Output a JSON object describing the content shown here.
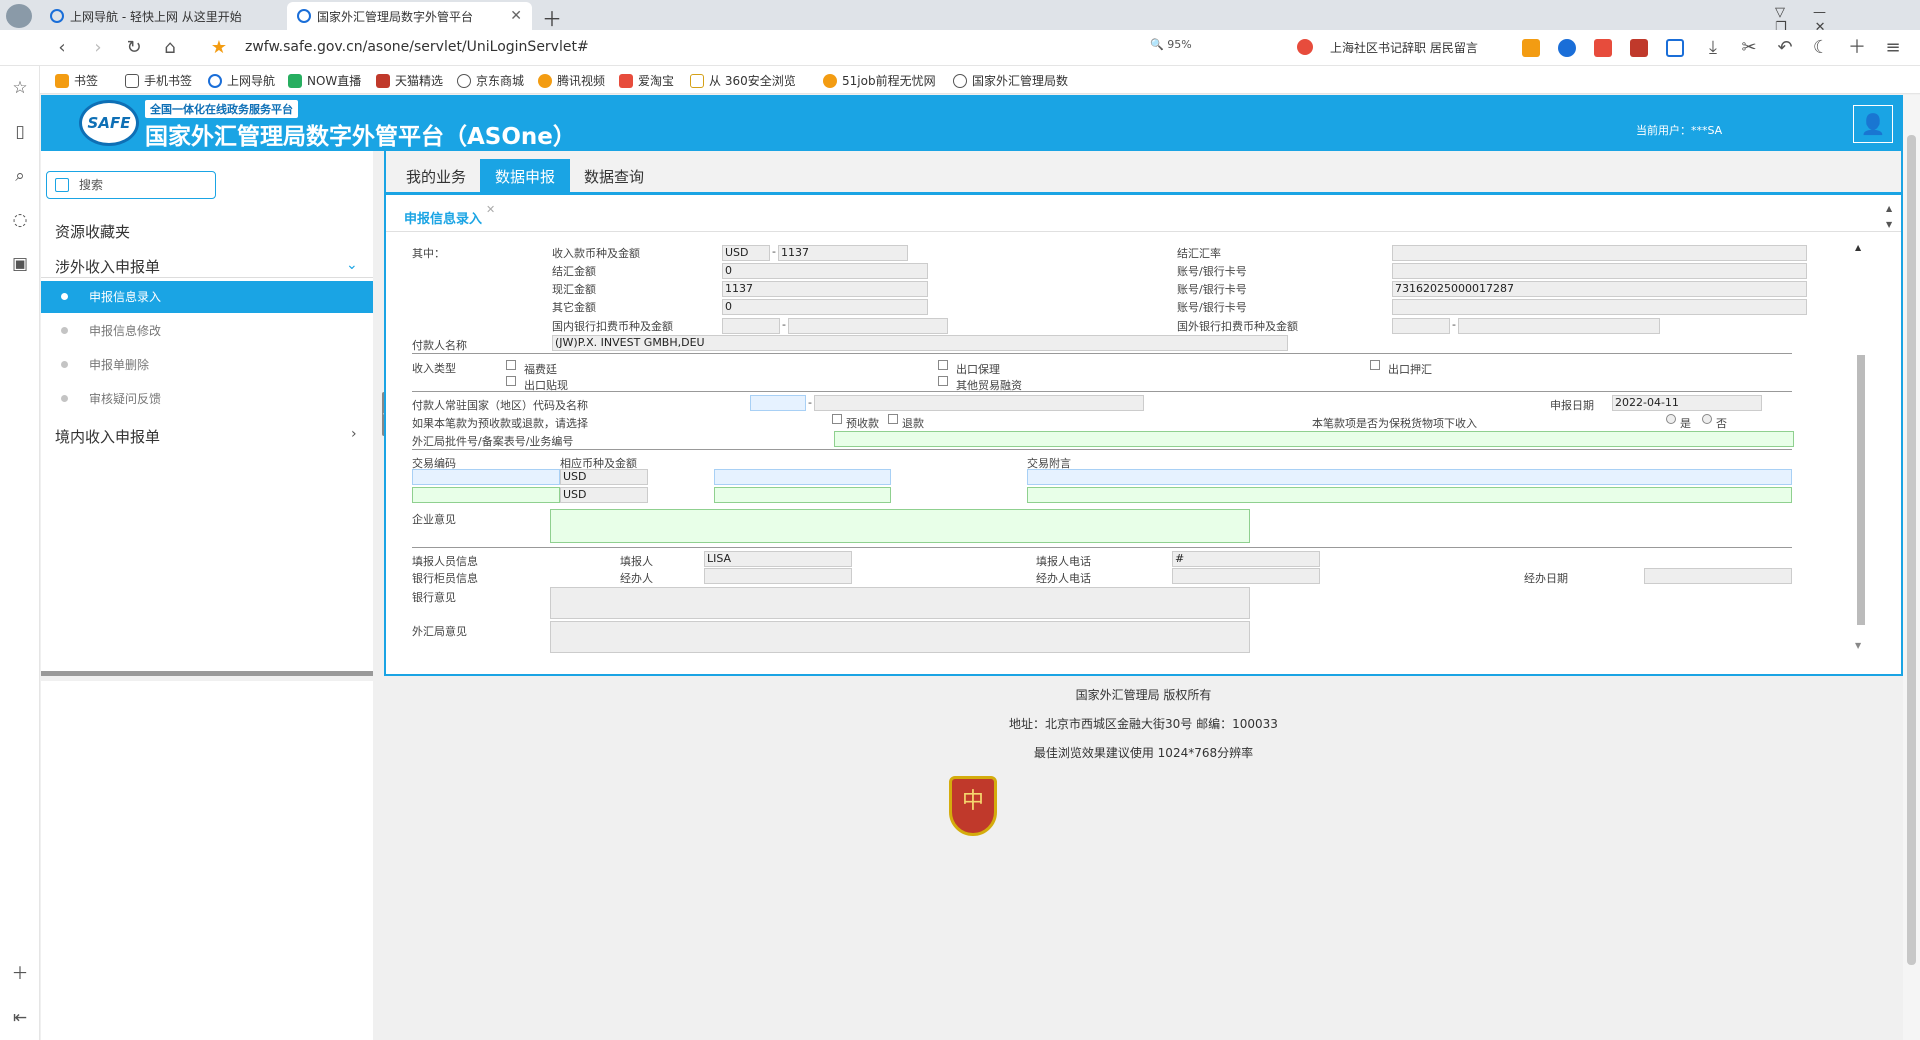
{
  "browser": {
    "tabs": [
      {
        "label": "上网导航 - 轻快上网 从这里开始"
      },
      {
        "label": "国家外汇管理局数字外管平台"
      }
    ],
    "url": "zwfw.safe.gov.cn/asone/servlet/UniLoginServlet#",
    "zoom": "95%",
    "search_text": "上海社区书记辞职 居民留言",
    "bookmarks": [
      "书签",
      "手机书签",
      "上网导航",
      "NOW直播",
      "天猫精选",
      "京东商城",
      "腾讯视频",
      "爱淘宝",
      "从 360安全浏览",
      "51job前程无忧网",
      "国家外汇管理局数"
    ]
  },
  "header": {
    "logo": "SAFE",
    "subtitle": "全国一体化在线政务服务平台",
    "title": "国家外汇管理局数字外管平台（ASOne）",
    "user": "当前用户：***SA"
  },
  "sidebar": {
    "search_label": "搜索",
    "favorites": "资源收藏夹",
    "group1": "涉外收入申报单",
    "group1_items": [
      "申报信息录入",
      "申报信息修改",
      "申报单删除",
      "审核疑问反馈"
    ],
    "group2": "境内收入申报单"
  },
  "main": {
    "tabs": [
      "我的业务",
      "数据申报",
      "数据查询"
    ],
    "subtab": "申报信息录入"
  },
  "form": {
    "label_qizhong": "其中：",
    "label_income_currency": "收入款币种及金额",
    "income_currency": "USD",
    "income_amount": "1137",
    "label_settlement_amount": "结汇金额",
    "settlement_amount": "0",
    "label_spot_amount": "现汇金额",
    "spot_amount": "1137",
    "label_other_amount": "其它金额",
    "other_amount": "0",
    "label_domestic_fee": "国内银行扣费币种及金额",
    "label_rate": "结汇汇率",
    "label_account1": "账号/银行卡号",
    "label_account2": "账号/银行卡号",
    "account2": "73162025000017287",
    "label_account3": "账号/银行卡号",
    "label_foreign_fee": "国外银行扣费币种及金额",
    "label_payer_name": "付款人名称",
    "payer_name": "(JW)P.X. INVEST GMBH,DEU",
    "label_income_type": "收入类型",
    "type_options": [
      "福费廷",
      "出口保理",
      "出口押汇",
      "出口贴现",
      "其他贸易融资"
    ],
    "label_payer_country": "付款人常驻国家（地区）代码及名称",
    "label_report_date": "申报日期",
    "report_date": "2022-04-11",
    "label_prepay_question": "如果本笔款为预收款或退款，请选择",
    "prepay_options": [
      "预收款",
      "退款"
    ],
    "label_bonded_question": "本笔款项是否为保税货物项下收入",
    "bonded_options": [
      "是",
      "否"
    ],
    "label_approval_no": "外汇局批件号/备案表号/业务编号",
    "label_trade_code": "交易编码",
    "label_trade_currency": "相应币种及金额",
    "trade_currency1": "USD",
    "trade_currency2": "USD",
    "label_trade_note": "交易附言",
    "label_enterprise_opinion": "企业意见",
    "label_filler_info": "填报人员信息",
    "label_filler": "填报人",
    "filler": "LISA",
    "label_filler_phone": "填报人电话",
    "filler_phone": "#",
    "label_teller_info": "银行柜员信息",
    "label_handler": "经办人",
    "label_handler_phone": "经办人电话",
    "label_handle_date": "经办日期",
    "label_bank_opinion": "银行意见",
    "label_safe_opinion": "外汇局意见",
    "dash": "-"
  },
  "footer": {
    "copyright": "国家外汇管理局 版权所有",
    "address": "地址：北京市西城区金融大街30号 邮编：100033",
    "resolution": "最佳浏览效果建议使用 1024*768分辨率",
    "badge": "中"
  }
}
